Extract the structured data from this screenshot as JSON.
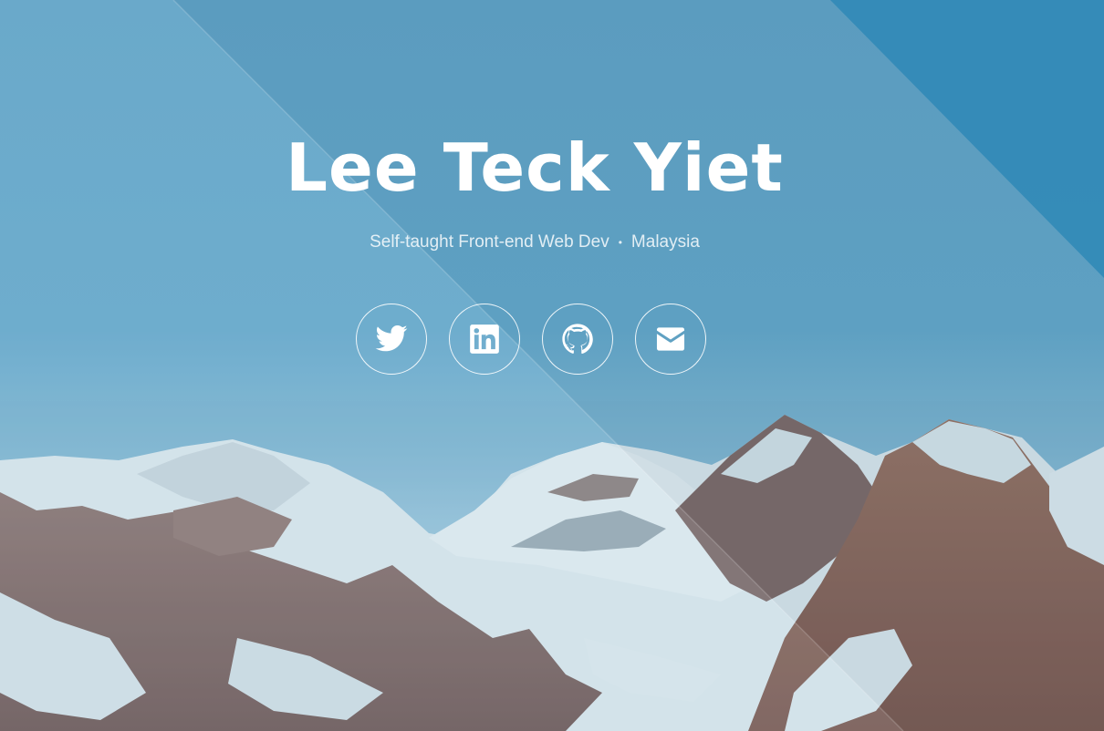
{
  "hero": {
    "name": "Lee Teck Yiet",
    "tagline": "Self-taught Front-end Web Dev",
    "separator": "•",
    "location": "Malaysia"
  },
  "socials": [
    {
      "icon": "twitter-icon",
      "label": "Twitter"
    },
    {
      "icon": "linkedin-icon",
      "label": "LinkedIn"
    },
    {
      "icon": "github-icon",
      "label": "GitHub"
    },
    {
      "icon": "envelope-icon",
      "label": "Email"
    }
  ],
  "colors": {
    "sky": "#5ea2c6",
    "accent_band": "#2e87b5",
    "text": "#ffffff",
    "snow": "#e8f1f4",
    "rock": "#7a5a52"
  }
}
